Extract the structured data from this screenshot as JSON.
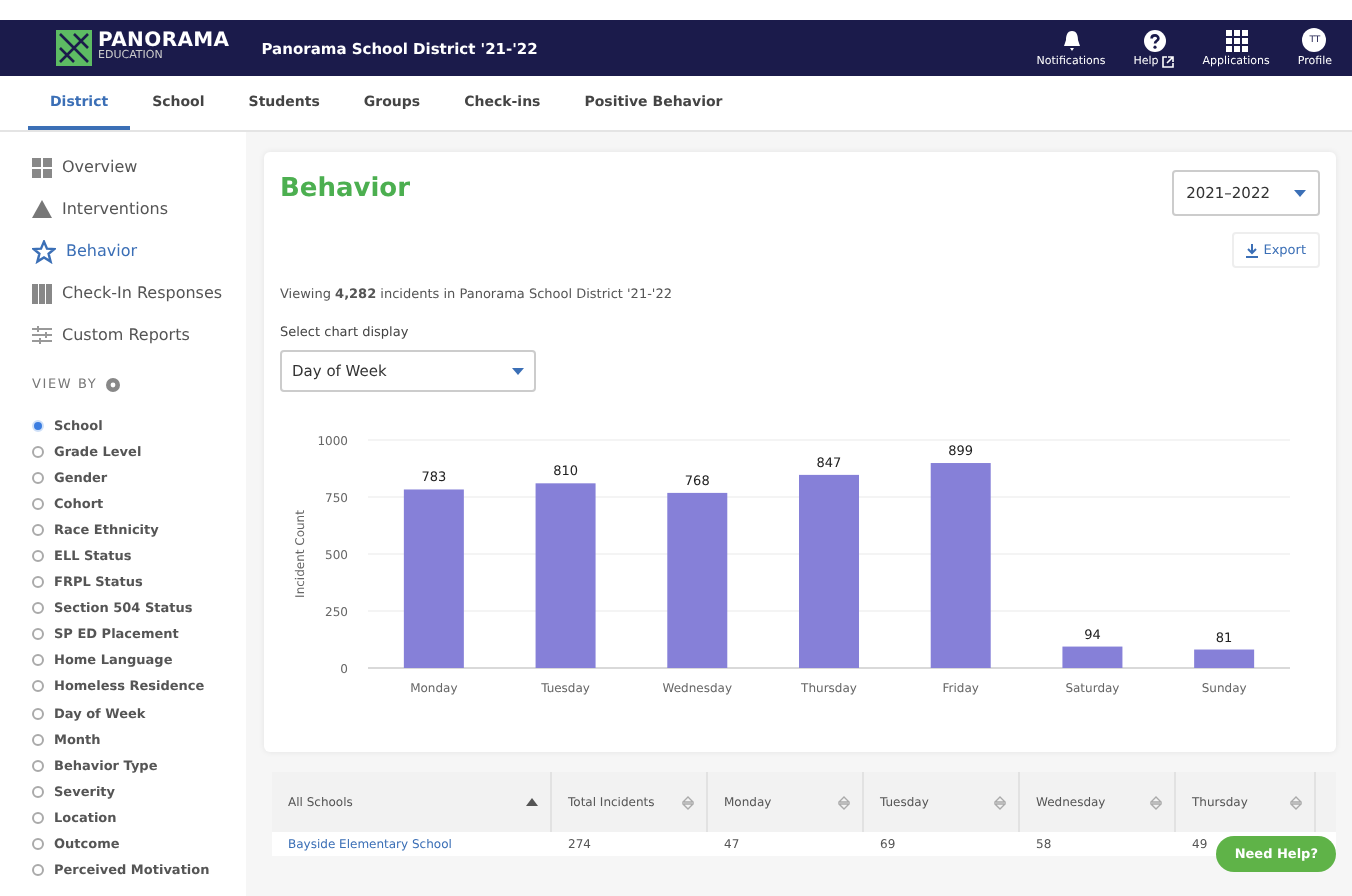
{
  "header": {
    "logo_name": "PANORAMA",
    "logo_sub": "EDUCATION",
    "district": "Panorama School District '21-'22",
    "actions": [
      {
        "kind": "bell",
        "label": "Notifications"
      },
      {
        "kind": "help",
        "label": "Help"
      },
      {
        "kind": "grid",
        "label": "Applications"
      },
      {
        "kind": "profile",
        "label": "Profile",
        "initials": "TT"
      }
    ]
  },
  "tabs": [
    {
      "label": "District",
      "selected": true
    },
    {
      "label": "School",
      "selected": false
    },
    {
      "label": "Students",
      "selected": false
    },
    {
      "label": "Groups",
      "selected": false
    },
    {
      "label": "Check-ins",
      "selected": false
    },
    {
      "label": "Positive Behavior",
      "selected": false
    }
  ],
  "sidebar": {
    "items": [
      {
        "kind": "overview",
        "label": "Overview",
        "selected": false
      },
      {
        "kind": "interventions",
        "label": "Interventions",
        "selected": false
      },
      {
        "kind": "behavior",
        "label": "Behavior",
        "selected": true
      },
      {
        "kind": "checkin",
        "label": "Check-In Responses",
        "selected": false
      },
      {
        "kind": "custom",
        "label": "Custom Reports",
        "selected": false
      }
    ],
    "view_by_label": "VIEW BY",
    "view_by": [
      {
        "label": "School",
        "selected": true
      },
      {
        "label": "Grade Level",
        "selected": false
      },
      {
        "label": "Gender",
        "selected": false
      },
      {
        "label": "Cohort",
        "selected": false
      },
      {
        "label": "Race Ethnicity",
        "selected": false
      },
      {
        "label": "ELL Status",
        "selected": false
      },
      {
        "label": "FRPL Status",
        "selected": false
      },
      {
        "label": "Section 504 Status",
        "selected": false
      },
      {
        "label": "SP ED Placement",
        "selected": false
      },
      {
        "label": "Home Language",
        "selected": false
      },
      {
        "label": "Homeless Residence",
        "selected": false
      },
      {
        "label": "Day of Week",
        "selected": false
      },
      {
        "label": "Month",
        "selected": false
      },
      {
        "label": "Behavior Type",
        "selected": false
      },
      {
        "label": "Severity",
        "selected": false
      },
      {
        "label": "Location",
        "selected": false
      },
      {
        "label": "Outcome",
        "selected": false
      },
      {
        "label": "Perceived Motivation",
        "selected": false
      }
    ]
  },
  "main": {
    "title": "Behavior",
    "year": "2021–2022",
    "export": "Export",
    "viewing": "Viewing **4,282** incidents in Panorama School District '21-'22",
    "select_label": "Select chart display",
    "select_value": "Day of Week",
    "chart_data": {
      "type": "bar",
      "ylabel": "Incident Count",
      "categories": [
        "Monday",
        "Tuesday",
        "Wednesday",
        "Thursday",
        "Friday",
        "Saturday",
        "Sunday"
      ],
      "series": [
        {
          "color": "#8680d8",
          "values": [
            783,
            810,
            768,
            847,
            899,
            94,
            81
          ]
        }
      ],
      "ylim": [
        0,
        1000
      ],
      "yticks": [
        0,
        250,
        500,
        750,
        1000
      ],
      "grid": true,
      "data_labels": true
    }
  },
  "table": {
    "columns": [
      {
        "label": "All Schools",
        "sorted": true
      },
      {
        "label": "Total Incidents",
        "sorted": false
      },
      {
        "label": "Monday",
        "sorted": false
      },
      {
        "label": "Tuesday",
        "sorted": false
      },
      {
        "label": "Wednesday",
        "sorted": false
      },
      {
        "label": "Thursday",
        "sorted": false
      }
    ],
    "rows": [
      [
        "Bayside Elementary School",
        "274",
        "47",
        "69",
        "58",
        "49"
      ]
    ]
  },
  "help_button": "Need Help?"
}
